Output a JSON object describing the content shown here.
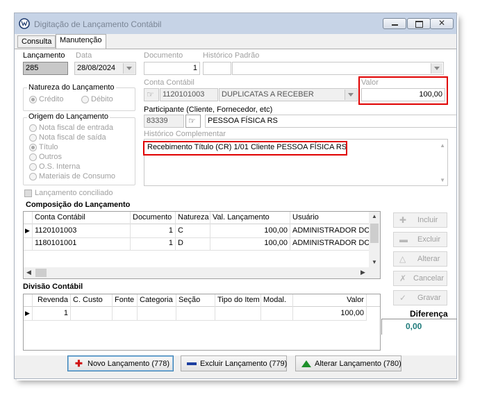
{
  "window": {
    "title": "Digitação de Lançamento Contábil"
  },
  "tabs": [
    {
      "label": "Consulta"
    },
    {
      "label": "Manutenção"
    }
  ],
  "form": {
    "lancamento_label": "Lançamento",
    "lancamento_value": "285",
    "data_label": "Data",
    "data_value": "28/08/2024",
    "documento_label": "Documento",
    "documento_value": "1",
    "historico_padrao_label": "Histórico Padrão",
    "historico_padrao_code": "",
    "historico_padrao_desc": "",
    "natureza": {
      "title": "Natureza do Lançamento",
      "options": [
        "Crédito",
        "Débito"
      ],
      "selected": "Crédito"
    },
    "conta_contabil_label": "Conta Contábil",
    "conta_contabil_value": "1120101003",
    "conta_contabil_desc": "DUPLICATAS A RECEBER",
    "valor_label": "Valor",
    "valor_value": "100,00",
    "origem": {
      "title": "Origem do Lançamento",
      "options": [
        "Nota fiscal de entrada",
        "Nota fiscal de saída",
        "Título",
        "Outros",
        "O.S. Interna",
        "Materiais de Consumo"
      ],
      "selected": "Título"
    },
    "participante_label": "Participante (Cliente, Fornecedor, etc)",
    "participante_code": "83339",
    "participante_name": "PESSOA FÍSICA  RS",
    "historico_complementar_label": "Histórico Complementar",
    "historico_complementar_value": "Recebimento Título (CR) 1/01 Cliente PESSOA FÍSICA  RS",
    "conciliado_label": "Lançamento conciliado"
  },
  "composicao": {
    "title": "Composição do Lançamento",
    "columns": [
      "Conta Contábil",
      "Documento",
      "Natureza",
      "Val. Lançamento",
      "Usuário"
    ],
    "rows": [
      [
        "1120101003",
        "1",
        "C",
        "100,00",
        "ADMINISTRADOR DC"
      ],
      [
        "1180101001",
        "1",
        "D",
        "100,00",
        "ADMINISTRADOR DC"
      ]
    ]
  },
  "divisao": {
    "title": "Divisão Contábil",
    "columns": [
      "Revenda",
      "C. Custo",
      "Fonte",
      "Categoria",
      "Seção",
      "Tipo do Item",
      "Modal.",
      "Valor"
    ],
    "rows": [
      [
        "1",
        "",
        "",
        "",
        "",
        "",
        "",
        "100,00"
      ]
    ]
  },
  "side_buttons": [
    {
      "label": "Incluir",
      "icon": "plus-icon"
    },
    {
      "label": "Excluir",
      "icon": "minus-icon"
    },
    {
      "label": "Alterar",
      "icon": "triangle-icon"
    },
    {
      "label": "Cancelar",
      "icon": "x-icon"
    },
    {
      "label": "Gravar",
      "icon": "check-icon"
    }
  ],
  "diferenca": {
    "label": "Diferença",
    "value": "0,00"
  },
  "bottom_buttons": [
    {
      "label": "Novo Lançamento (778)",
      "icon": "red-plus-icon"
    },
    {
      "label": "Excluir Lançamento (779)",
      "icon": "blue-minus-icon"
    },
    {
      "label": "Alterar Lançamento (780)",
      "icon": "green-triangle-icon"
    }
  ],
  "colors": {
    "highlight": "#e00000",
    "diferenca": "#1e7a7a",
    "title_bar": "#c6d3e6"
  }
}
